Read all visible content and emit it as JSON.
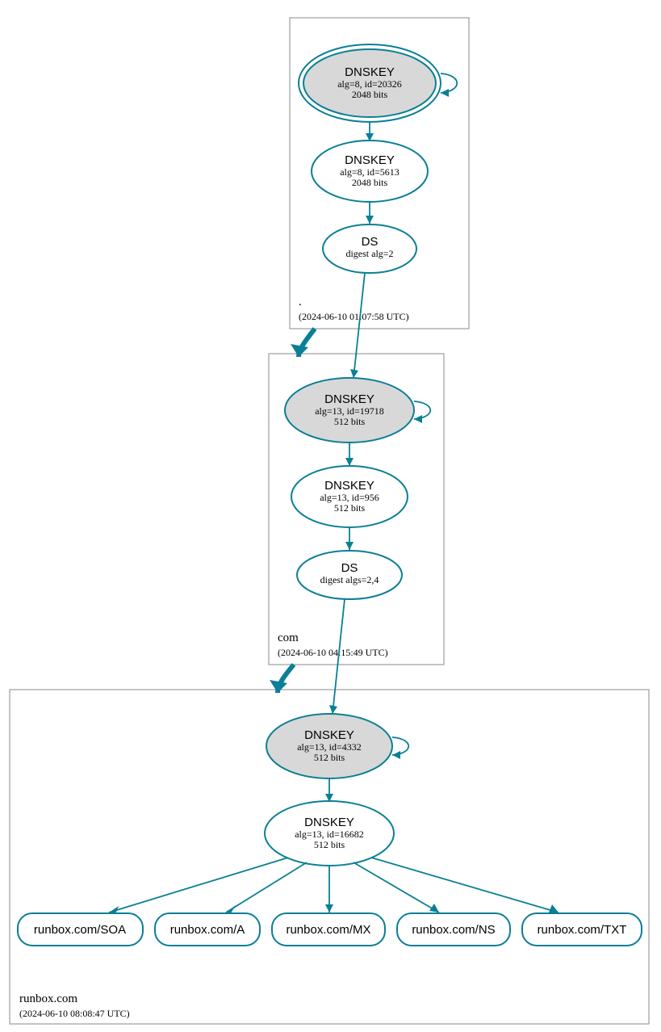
{
  "colors": {
    "accent": "#0a7f96",
    "ksk_fill": "#d8d8d8"
  },
  "zones": {
    "root": {
      "name": ".",
      "timestamp": "(2024-06-10 01:07:58 UTC)"
    },
    "com": {
      "name": "com",
      "timestamp": "(2024-06-10 04:15:49 UTC)"
    },
    "leaf": {
      "name": "runbox.com",
      "timestamp": "(2024-06-10 08:08:47 UTC)"
    }
  },
  "nodes": {
    "root_ksk": {
      "title": "DNSKEY",
      "line1": "alg=8, id=20326",
      "line2": "2048 bits"
    },
    "root_zsk": {
      "title": "DNSKEY",
      "line1": "alg=8, id=5613",
      "line2": "2048 bits"
    },
    "root_ds": {
      "title": "DS",
      "line1": "digest alg=2"
    },
    "com_ksk": {
      "title": "DNSKEY",
      "line1": "alg=13, id=19718",
      "line2": "512 bits"
    },
    "com_zsk": {
      "title": "DNSKEY",
      "line1": "alg=13, id=956",
      "line2": "512 bits"
    },
    "com_ds": {
      "title": "DS",
      "line1": "digest algs=2,4"
    },
    "leaf_ksk": {
      "title": "DNSKEY",
      "line1": "alg=13, id=4332",
      "line2": "512 bits"
    },
    "leaf_zsk": {
      "title": "DNSKEY",
      "line1": "alg=13, id=16682",
      "line2": "512 bits"
    }
  },
  "rrsets": {
    "soa": "runbox.com/SOA",
    "a": "runbox.com/A",
    "mx": "runbox.com/MX",
    "ns": "runbox.com/NS",
    "txt": "runbox.com/TXT"
  }
}
